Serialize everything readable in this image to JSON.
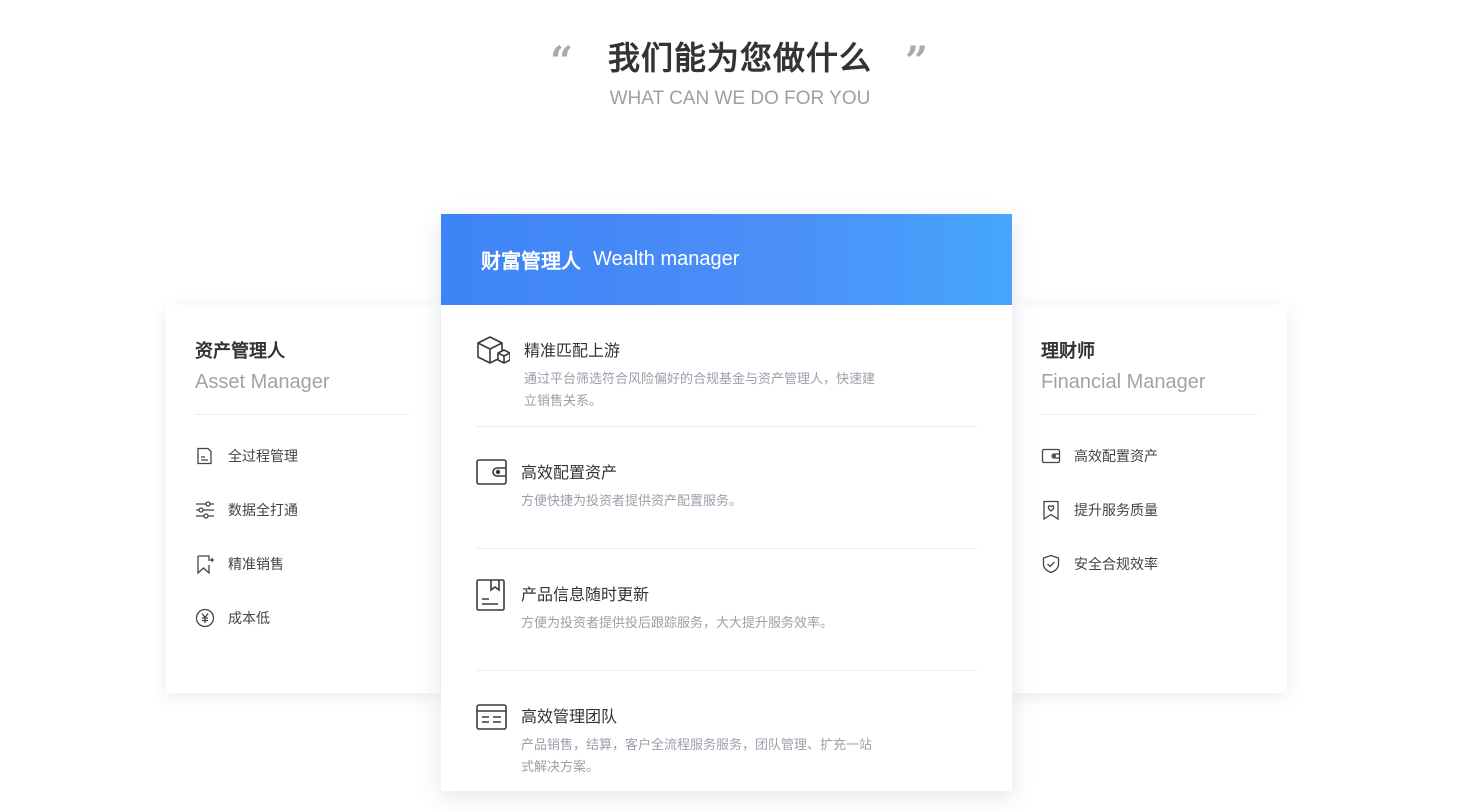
{
  "section": {
    "title": "我们能为您做什么",
    "subtitle": "WHAT CAN WE DO FOR YOU",
    "quote_open": "“",
    "quote_close": "”"
  },
  "left_card": {
    "title": "资产管理人",
    "subtitle": "Asset Manager",
    "items": [
      {
        "label": "全过程管理",
        "icon": "document-icon"
      },
      {
        "label": "数据全打通",
        "icon": "sliders-icon"
      },
      {
        "label": "精准销售",
        "icon": "bookmark-icon"
      },
      {
        "label": "成本低",
        "icon": "yen-coin-icon"
      }
    ]
  },
  "center_card": {
    "title_cn": "财富管理人",
    "title_en": "Wealth manager",
    "features": [
      {
        "title": "精准匹配上游",
        "desc": "通过平台筛选符合风险偏好的合规基金与资产管理人，快速建立销售关系。",
        "icon": "cube-boxes-icon"
      },
      {
        "title": "高效配置资产",
        "desc": "方便快捷为投资者提供资产配置服务。",
        "icon": "wallet-icon"
      },
      {
        "title": "产品信息随时更新",
        "desc": "方便为投资者提供投后跟踪服务，大大提升服务效率。",
        "icon": "bookmark-document-icon"
      },
      {
        "title": "高效管理团队",
        "desc": "产品销售，结算，客户全流程服务服务，团队管理、扩充一站式解决方案。",
        "icon": "list-panel-icon"
      }
    ]
  },
  "right_card": {
    "title": "理财师",
    "subtitle": "Financial Manager",
    "items": [
      {
        "label": "高效配置资产",
        "icon": "wallet-icon"
      },
      {
        "label": "提升服务质量",
        "icon": "badge-heart-icon"
      },
      {
        "label": "安全合规效率",
        "icon": "shield-check-icon"
      }
    ]
  },
  "colors": {
    "accent_start": "#3e83f7",
    "accent_end": "#45a6fc",
    "text_primary": "#333333",
    "text_secondary": "#9aa0aa"
  }
}
